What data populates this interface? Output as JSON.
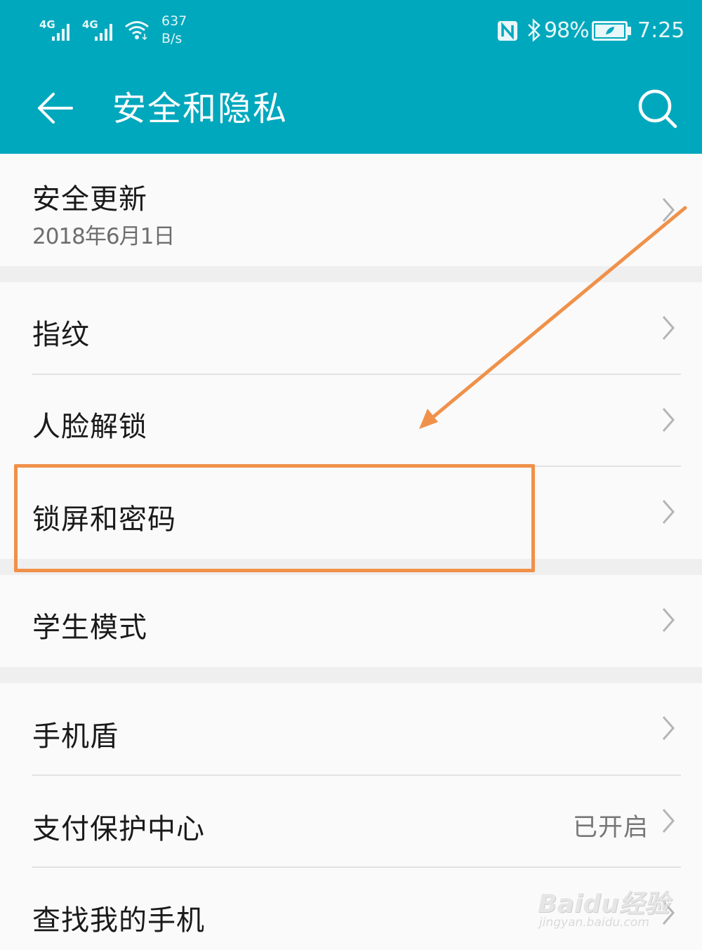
{
  "status_bar": {
    "sim1_network": "4G",
    "sim2_network": "4G",
    "speed_value": "637",
    "speed_unit": "B/s",
    "battery_percent": "98%",
    "time": "7:25"
  },
  "header": {
    "title": "安全和隐私",
    "back_icon": "back-arrow-icon",
    "search_icon": "search-icon"
  },
  "colors": {
    "header_bg": "#00a8bd",
    "highlight": "#f0914a",
    "page_bg": "#fafafa"
  },
  "settings": {
    "security_update": {
      "label": "安全更新",
      "subtitle": "2018年6月1日"
    },
    "fingerprint": {
      "label": "指纹"
    },
    "face_unlock": {
      "label": "人脸解锁"
    },
    "lock_screen": {
      "label": "锁屏和密码"
    },
    "student_mode": {
      "label": "学生模式"
    },
    "phone_shield": {
      "label": "手机盾"
    },
    "payment_protection": {
      "label": "支付保护中心",
      "value": "已开启"
    },
    "find_my_phone": {
      "label": "查找我的手机"
    }
  },
  "watermark": {
    "brand": "Baidu经验",
    "url": "jingyan.baidu.com"
  }
}
